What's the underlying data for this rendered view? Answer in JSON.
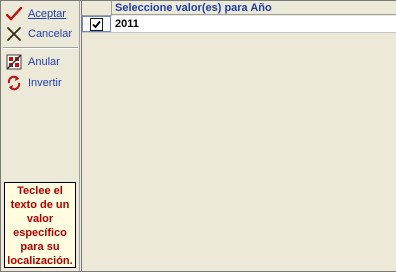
{
  "toolbar": {
    "accept_label": "Aceptar",
    "cancel_label": "Cancelar",
    "clear_label": "Anular",
    "invert_label": "Invertir"
  },
  "hint": {
    "lines": [
      "Teclee el",
      "texto de un",
      "valor",
      "específico",
      "para su",
      "localización."
    ]
  },
  "grid": {
    "column_header": "Seleccione valor(es) para Año",
    "rows": [
      {
        "checked": true,
        "value": "2011"
      }
    ]
  },
  "colors": {
    "accent_text": "#1f3fa8",
    "hint_text": "#b00000",
    "hint_bg": "#fffce0",
    "panel_bg": "#ece9d8"
  },
  "icons": {
    "accept": "check-icon",
    "cancel": "close-icon",
    "clear": "clear-icon",
    "invert": "invert-icon"
  }
}
